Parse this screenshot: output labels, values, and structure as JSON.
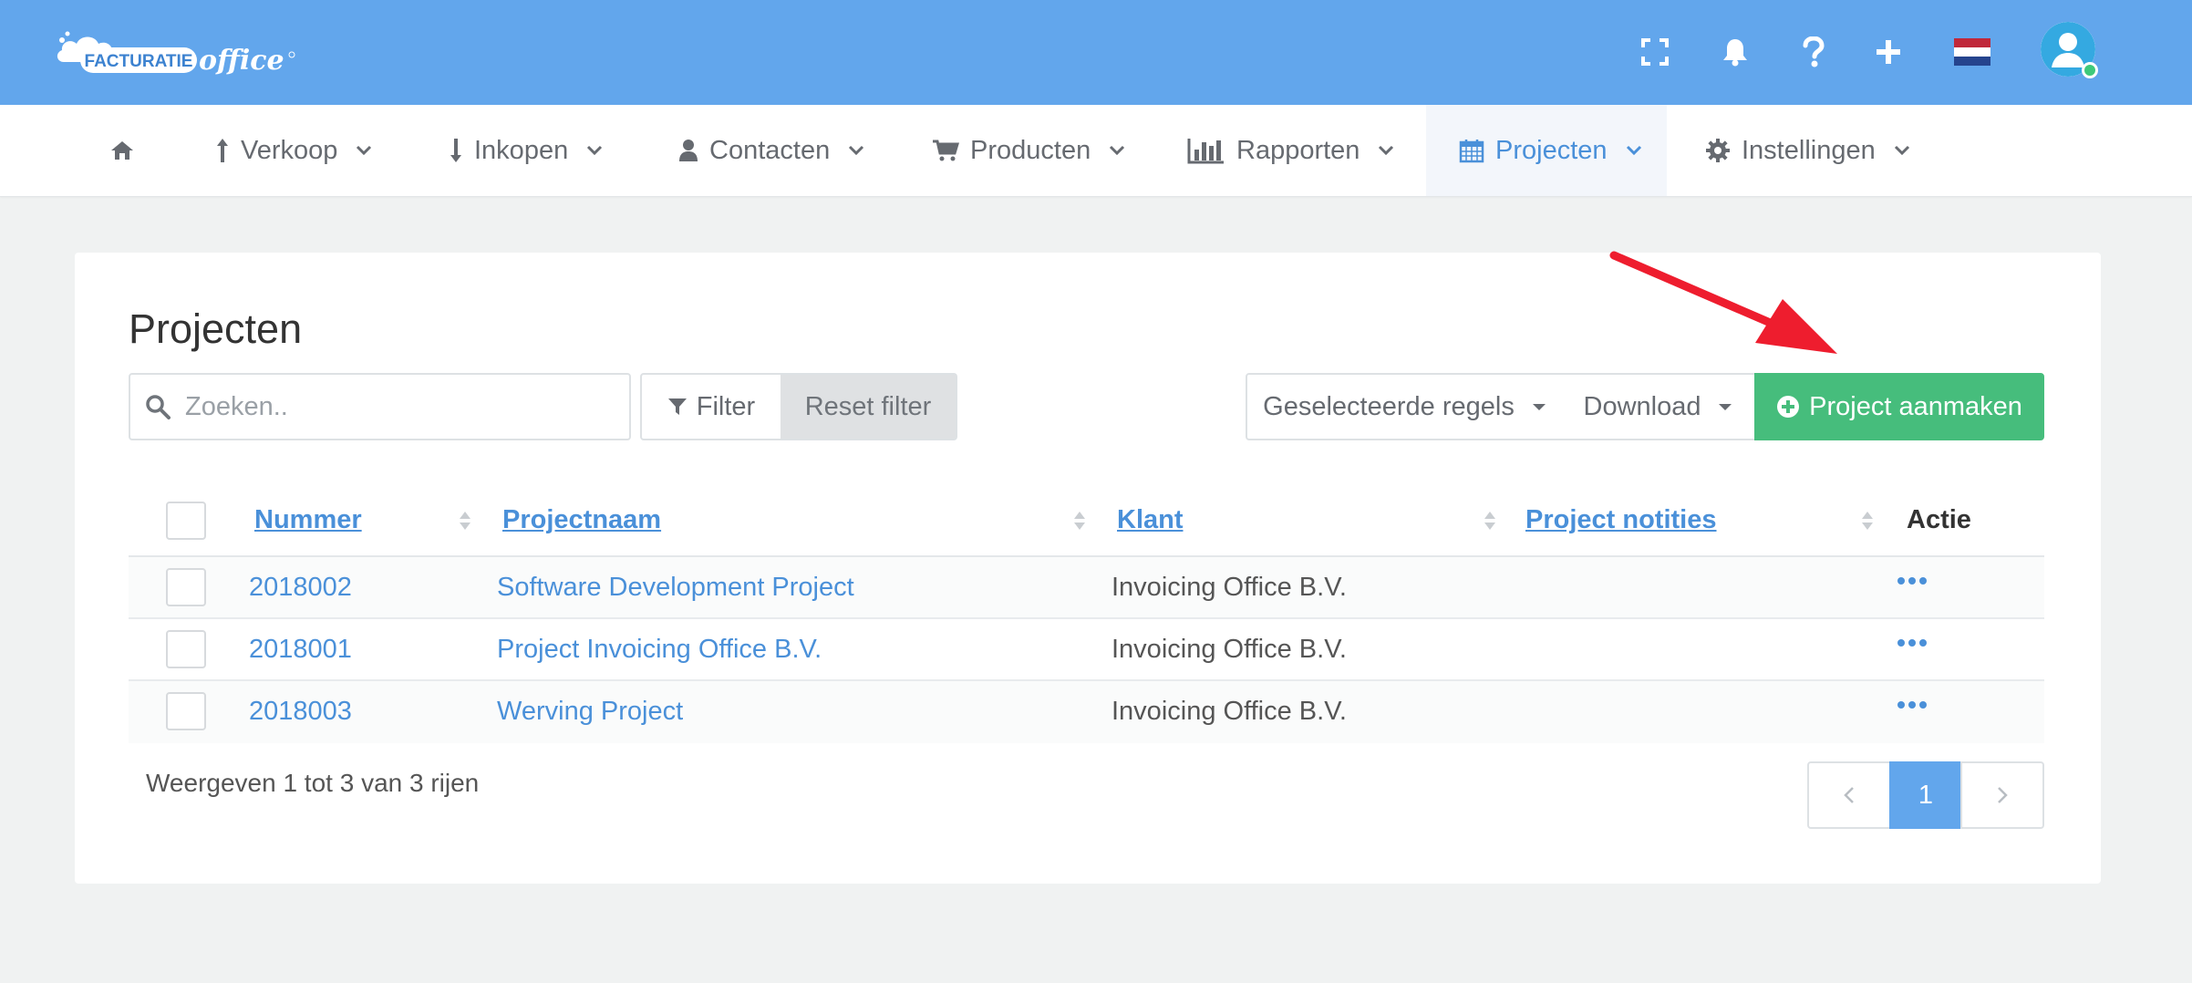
{
  "header": {
    "logo_text": "FACTURATIE",
    "logo_script": "office",
    "language": "nl"
  },
  "nav": {
    "items": [
      {
        "label": "",
        "icon": "home-icon"
      },
      {
        "label": "Verkoop",
        "icon": "arrow-up-icon"
      },
      {
        "label": "Inkopen",
        "icon": "arrow-down-icon"
      },
      {
        "label": "Contacten",
        "icon": "user-icon"
      },
      {
        "label": "Producten",
        "icon": "cart-icon"
      },
      {
        "label": "Rapporten",
        "icon": "bar-chart-icon"
      },
      {
        "label": "Projecten",
        "icon": "calendar-icon",
        "active": true
      },
      {
        "label": "Instellingen",
        "icon": "gear-icon"
      }
    ]
  },
  "page": {
    "title": "Projecten",
    "search_placeholder": "Zoeken..",
    "filter_label": "Filter",
    "reset_label": "Reset filter",
    "selected_rows_label": "Geselecteerde regels",
    "download_label": "Download",
    "create_label": "Project aanmaken"
  },
  "table": {
    "columns": [
      "Nummer",
      "Projectnaam",
      "Klant",
      "Project notities",
      "Actie"
    ],
    "rows": [
      {
        "nummer": "2018002",
        "projectnaam": "Software Development Project",
        "klant": "Invoicing Office B.V.",
        "notities": ""
      },
      {
        "nummer": "2018001",
        "projectnaam": "Project Invoicing Office B.V.",
        "klant": "Invoicing Office B.V.",
        "notities": ""
      },
      {
        "nummer": "2018003",
        "projectnaam": "Werving Project",
        "klant": "Invoicing Office B.V.",
        "notities": ""
      }
    ]
  },
  "footer": {
    "summary": "Weergeven 1 tot 3 van 3 rijen",
    "current_page": "1"
  },
  "colors": {
    "header_bg": "#62a6ec",
    "link": "#4a90d9",
    "create_button": "#46bd7c",
    "annotation_arrow": "#ee1d2e"
  }
}
